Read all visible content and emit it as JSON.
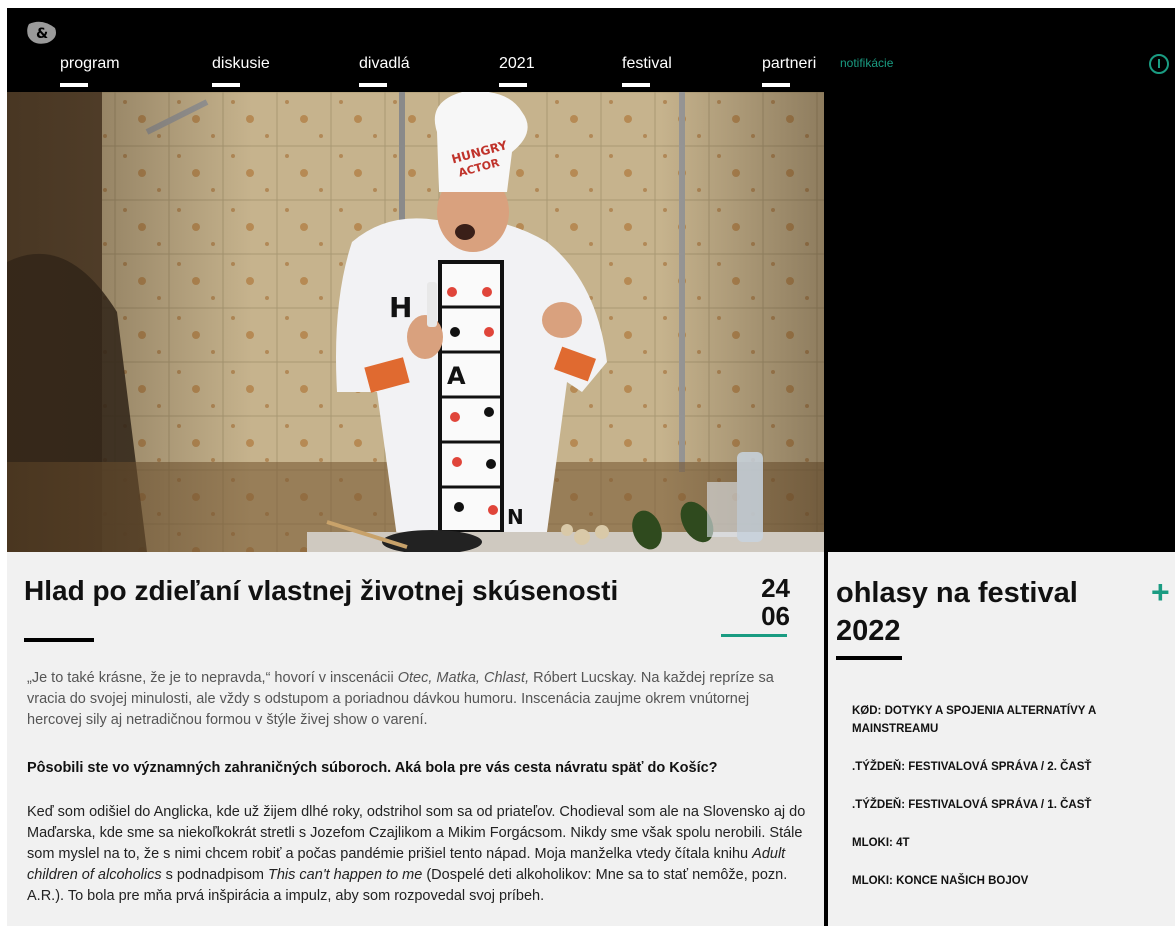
{
  "nav": {
    "items": [
      {
        "label": "program"
      },
      {
        "label": "diskusie"
      },
      {
        "label": "divadlá"
      },
      {
        "label": "2021"
      },
      {
        "label": "festival"
      },
      {
        "label": "partneri"
      }
    ],
    "notifications": "notifikácie"
  },
  "icons": {
    "logo": "ampersand-logo-icon",
    "power": "power-icon",
    "plus": "plus-icon"
  },
  "colors": {
    "accent": "#1a9c82",
    "background": "#000000",
    "panel": "#f1f1f1"
  },
  "article": {
    "title": "Hlad po zdieľaní vlastnej životnej skúsenosti",
    "date_day": "24",
    "date_month": "06",
    "lead_1": "„Je to také krásne, že je to nepravda,“ hovorí v inscenácii ",
    "lead_em_1": "Otec, Matka, Chlast,",
    "lead_2": " Róbert Lucskay. Na každej repríze sa vracia do svojej minulosti, ale vždy s odstupom a poriadnou dávkou humoru. Inscenácia zaujme okrem vnútornej hercovej sily aj netradičnou formou v štýle živej show o varení.",
    "question": "Pôsobili ste vo významných zahraničných súboroch. Aká bola pre vás cesta návratu späť do Košíc?",
    "body_1": "Keď som odišiel do Anglicka, kde už žijem dlhé roky, odstrihol som sa od priateľov. Chodieval som ale na Slovensko aj do Maďarska, kde sme sa niekoľkokrát stretli s Jozefom Czajlikom a Mikim Forgácsom. Nikdy sme však spolu nerobili. Stále som myslel na to, že s nimi chcem robiť a počas pandémie prišiel tento nápad. Moja manželka vtedy čítala knihu ",
    "body_em_1": "Adult children of alcoholics",
    "body_2": " s podnadpisom ",
    "body_em_2": "This can't happen to me",
    "body_3": " (Dospelé deti alkoholikov: Mne sa to stať nemôže, pozn. A.R.). To bola pre mňa prvá inšpirácia a impulz, aby som rozpovedal svoj príbeh."
  },
  "side": {
    "title": "ohlasy na festival 2022",
    "items": [
      "KØD: DOTYKY A SPOJENIA ALTERNATÍVY A MAINSTREAMU",
      ".TÝŽDEŇ: FESTIVALOVÁ SPRÁVA / 2. ČASŤ",
      ".TÝŽDEŇ: FESTIVALOVÁ SPRÁVA / 1. ČASŤ",
      "MLOKI: 4T",
      "MLOKI: KONCE NAŠICH BOJOV"
    ]
  },
  "hero": {
    "hat_text_1": "HUNGRY",
    "hat_text_2": "ACTOR",
    "apron_text_1": "H",
    "apron_text_2": "A",
    "apron_text_3": "N"
  }
}
